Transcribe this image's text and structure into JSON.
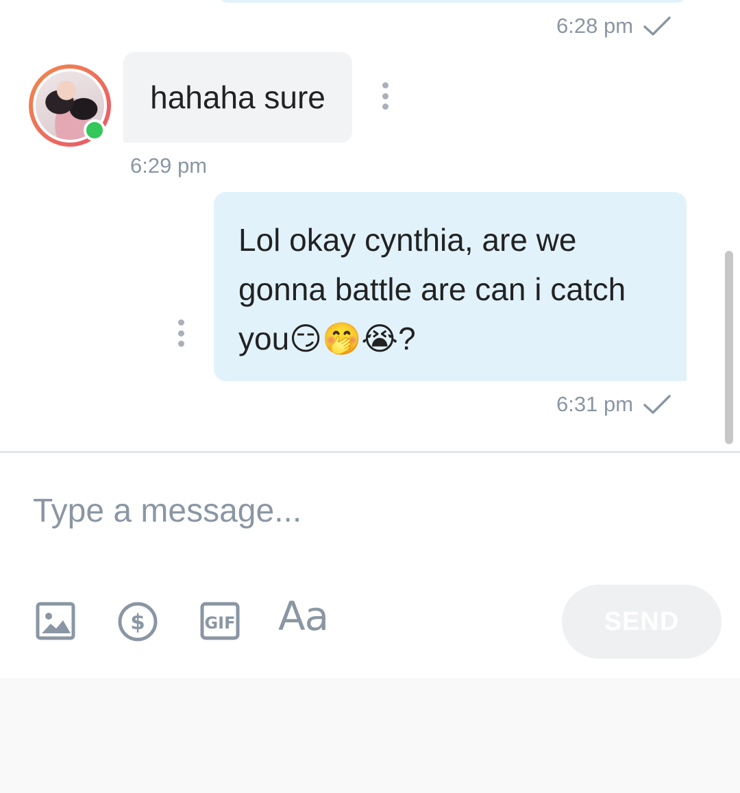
{
  "messages": [
    {
      "direction": "outgoing",
      "text": "",
      "time": "6:28 pm",
      "status_icon": "check-icon"
    },
    {
      "direction": "incoming",
      "text": "hahaha sure",
      "time": "6:29 pm",
      "sender_online": true
    },
    {
      "direction": "outgoing",
      "text": "Lol okay cynthia, are we gonna battle are can i catch you😏🤭😭?",
      "time": "6:31 pm",
      "status_icon": "check-icon"
    }
  ],
  "composer": {
    "placeholder": "Type a message...",
    "value": "",
    "tools": [
      "image-icon",
      "dollar-icon",
      "gif-icon",
      "text-format-icon"
    ],
    "text_format_label": "Aa",
    "send_label": "SEND"
  },
  "colors": {
    "outgoing_bubble": "#e1f2fb",
    "incoming_bubble": "#f1f3f5",
    "online": "#34c759",
    "muted_text": "#8a96a3"
  }
}
